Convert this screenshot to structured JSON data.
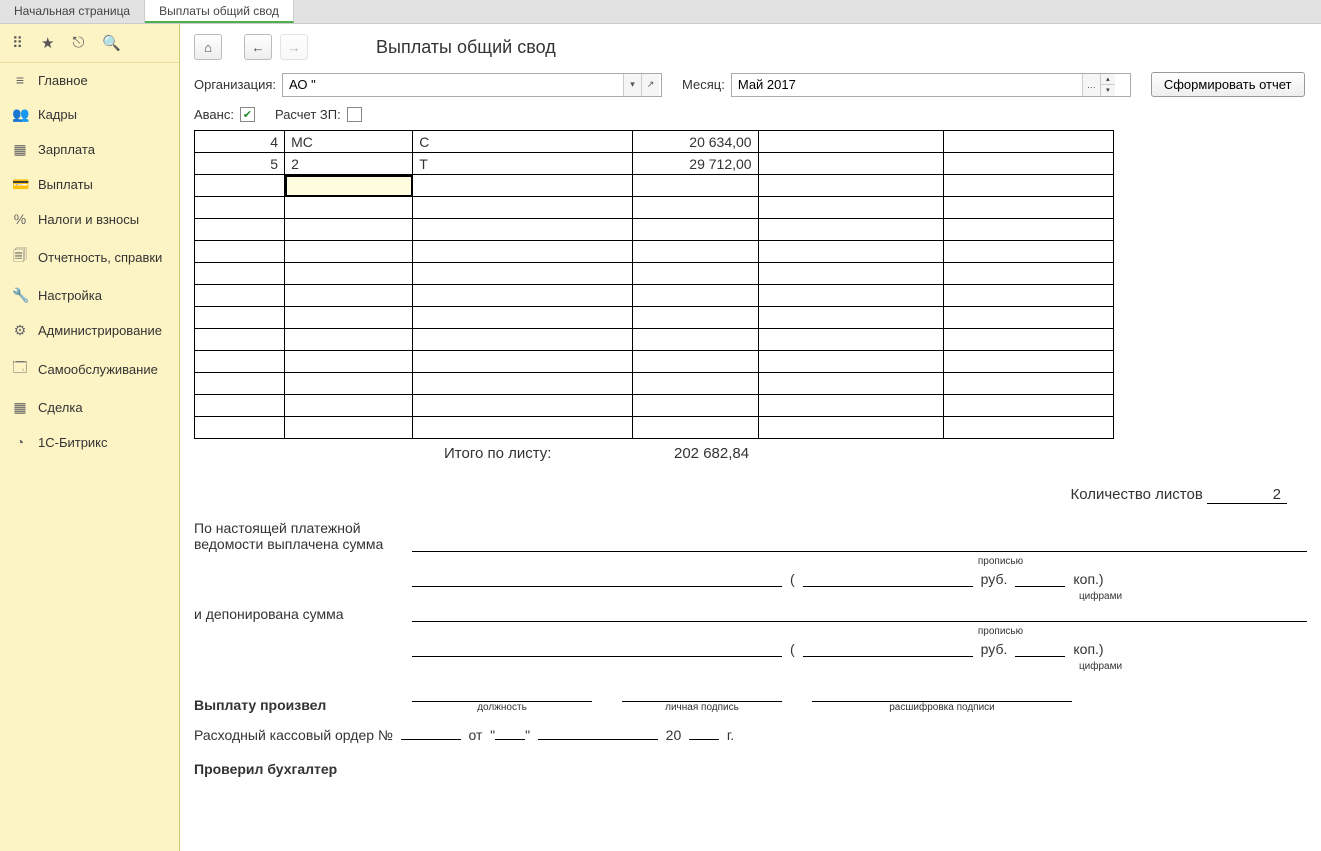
{
  "tabs": [
    {
      "label": "Начальная страница",
      "active": false
    },
    {
      "label": "Выплаты общий свод",
      "active": true
    }
  ],
  "sidebar": {
    "items": [
      {
        "icon": "≡",
        "label": "Главное"
      },
      {
        "icon": "👥",
        "label": "Кадры"
      },
      {
        "icon": "▦",
        "label": "Зарплата"
      },
      {
        "icon": "💳",
        "label": "Выплаты"
      },
      {
        "icon": "%",
        "label": "Налоги и взносы"
      },
      {
        "icon": "🗐",
        "label": "Отчетность, справки"
      },
      {
        "icon": "🔧",
        "label": "Настройка"
      },
      {
        "icon": "⚙",
        "label": "Администрирование"
      },
      {
        "icon": "🗔",
        "label": "Самообслуживание"
      },
      {
        "icon": "▦",
        "label": "Сделка"
      },
      {
        "icon": "◔",
        "label": "1С-Битрикс"
      }
    ]
  },
  "page": {
    "title": "Выплаты общий свод",
    "org_label": "Организация:",
    "org_value": "АО \"",
    "month_label": "Месяц:",
    "month_value": "Май 2017",
    "generate_btn": "Сформировать отчет",
    "advance_label": "Аванс:",
    "advance_checked": true,
    "zp_label": "Расчет ЗП:",
    "zp_checked": false
  },
  "grid": {
    "rows": [
      {
        "n": "4",
        "a": "МС",
        "b": "С",
        "sum": "20 634,00"
      },
      {
        "n": "5",
        "a": "2",
        "b": "Т",
        "sum": "29 712,00"
      }
    ]
  },
  "totals": {
    "label": "Итого по листу:",
    "value": "202 682,84"
  },
  "sheets": {
    "label": "Количество листов",
    "value": "2"
  },
  "form": {
    "paid_label1": "По настоящей платежной",
    "paid_label2": "ведомости выплачена сумма",
    "propis": "прописью",
    "rub": "руб.",
    "kop": "коп.)",
    "digits": "цифрами",
    "depon": "и депонирована сумма",
    "payer": "Выплату произвел",
    "position": "должность",
    "sign": "личная подпись",
    "decode": "расшифровка подписи",
    "order": "Расходный кассовый ордер №",
    "from": "от",
    "year20": "20",
    "g": "г.",
    "checked": "Проверил бухгалтер"
  }
}
